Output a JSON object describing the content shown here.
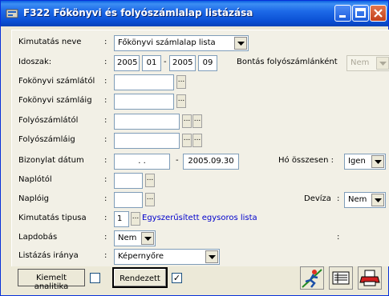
{
  "window": {
    "title": "F322 Főkönyvi és folyószámlalap listázása"
  },
  "form": {
    "kimutatas_neve": {
      "label": "Kimutatás neve",
      "value": "Főkönyvi számlalap lista"
    },
    "idoszak": {
      "label": "Idoszak:",
      "from_year": "2005",
      "from_month": "01",
      "to_year": "2005",
      "to_month": "09",
      "separator": "-"
    },
    "bontas": {
      "label": "Bontás folyószámlánként",
      "value": "Nem"
    },
    "fokonyvi_tol": {
      "label": "Fokönyvi  számlától",
      "value": ""
    },
    "fokonyvi_ig": {
      "label": "Fokönyvi számláig",
      "value": ""
    },
    "folyo_tol": {
      "label": "Folyószámlától",
      "value": ""
    },
    "folyo_ig": {
      "label": "Folyószámláig",
      "value": ""
    },
    "bizonylat": {
      "label": "Bizonylat dátum",
      "from": " .  .",
      "to": "2005.09.30",
      "separator": "-"
    },
    "ho_osszesen": {
      "label": "Hó összesen :",
      "value": "Igen"
    },
    "naplotol": {
      "label": "Naplótól",
      "value": ""
    },
    "naploig": {
      "label": "Naplóig",
      "value": ""
    },
    "deviza": {
      "label": "Devíza",
      "value": "Nem"
    },
    "tipus": {
      "label": "Kimutatás tipusa",
      "value": "1",
      "description": "Egyszerűsített egysoros lista"
    },
    "lapdobas": {
      "label": "Lapdobás",
      "value": "Nem"
    },
    "listazas": {
      "label": "Listázás iránya",
      "value": "Képernyőre"
    },
    "colon": ":",
    "dots": "..."
  },
  "bottom": {
    "kiemelt_label": "Kiemelt analitika",
    "rendezett_label": "Rendezett",
    "rendezett_checked": "✓"
  }
}
